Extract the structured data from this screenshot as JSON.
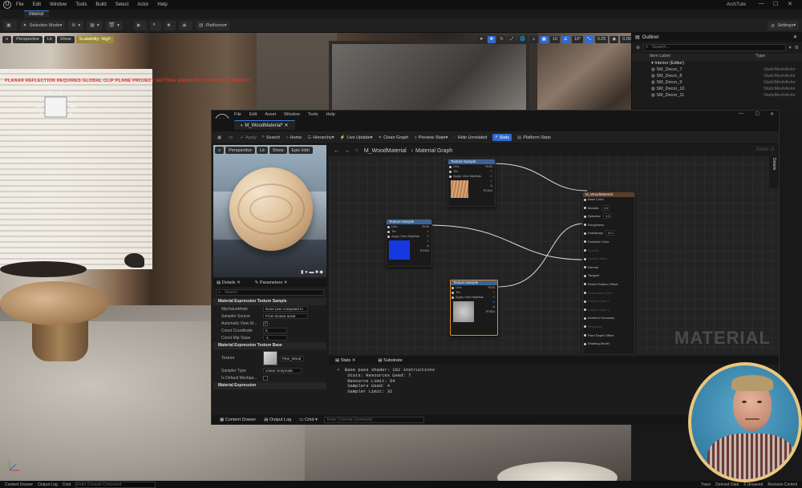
{
  "menubar": {
    "items": [
      "File",
      "Edit",
      "Window",
      "Tools",
      "Build",
      "Select",
      "Actor",
      "Help"
    ],
    "app_name": "ArchTute"
  },
  "level_tab": "Interior",
  "toolbar": {
    "selection_mode": "Selection Mode",
    "platforms": "Platforms",
    "settings": "Settings"
  },
  "viewport": {
    "perspective": "Perspective",
    "lit": "Lit",
    "show": "Show",
    "scalability": "Scalability: High",
    "warning": "PLANAR REFLECTION REQUIRES GLOBAL CLIP PLANE PROJECT SETTING ENABLED TO WORK PROPERLY",
    "grid_size": "10",
    "rotation_snap": "10°",
    "scale_snap": "0.25",
    "camera_speed": "0.002"
  },
  "outliner": {
    "title": "Outliner",
    "search_placeholder": "Search...",
    "col_label": "Item Label",
    "col_type": "Type",
    "root": "Interior (Editor)",
    "rows": [
      {
        "name": "SM_Decor_7",
        "type": "StaticMeshActor"
      },
      {
        "name": "SM_Decor_8",
        "type": "StaticMeshActor"
      },
      {
        "name": "SM_Decor_9",
        "type": "StaticMeshActor"
      },
      {
        "name": "SM_Decor_10",
        "type": "StaticMeshActor"
      },
      {
        "name": "SM_Decor_11",
        "type": "StaticMeshActor"
      }
    ]
  },
  "material_editor": {
    "menu": [
      "File",
      "Edit",
      "Asset",
      "Window",
      "Tools",
      "Help"
    ],
    "tab": "M_WoodMaterial*",
    "toolbar": {
      "apply": "Apply",
      "search": "Search",
      "home": "Home",
      "hierarchy": "Hierarchy",
      "live_update": "Live Update",
      "clean_graph": "Clean Graph",
      "preview_state": "Preview State",
      "hide_unrelated": "Hide Unrelated",
      "stats": "Stats",
      "platform_stats": "Platform Stats"
    },
    "preview": {
      "perspective": "Perspective",
      "lit": "Lit",
      "show": "Show",
      "epic_hdri": "Epic Hdri"
    },
    "left_tabs": {
      "details": "Details",
      "parameters": "Parameters"
    },
    "details": {
      "search_placeholder": "Search",
      "section1": "Material Expression Texture Sample",
      "props1": [
        {
          "k": "MipValueMode",
          "v": "None (use computed m"
        },
        {
          "k": "Sampler Source",
          "v": "From texture asset"
        },
        {
          "k": "Automatic View M...",
          "v": "✓"
        },
        {
          "k": "Const Coordinate",
          "v": "0"
        },
        {
          "k": "Const Mip Value",
          "v": "-1"
        }
      ],
      "section2": "Material Expression Texture Base",
      "texture_label": "Texture",
      "texture_value": "Pine_Wood",
      "sampler_type_label": "Sampler Type",
      "sampler_type_value": "Linear Grayscale",
      "default_meshpaint_label": "Is Default Meshpa...",
      "section3": "Material Expression"
    },
    "graph": {
      "breadcrumb_root": "M_WoodMaterial",
      "breadcrumb_child": "Material Graph",
      "zoom": "Zoom -3",
      "watermark": "MATERIAL",
      "details_side": "Details",
      "texture_node_title": "Texture Sample",
      "pins_uv": "UVs",
      "pins_tex": "Tex",
      "pins_apply": "Apply View MipBias",
      "out_rgb": "RGB",
      "out_r": "R",
      "out_g": "G",
      "out_b": "B",
      "out_a": "A",
      "out_rgba": "RGBA",
      "main_title": "M_WoodMaterial",
      "main_pins": [
        "Base Color",
        "Metallic",
        "Specular",
        "Roughness",
        "Anisotropy",
        "Emissive Color",
        "Opacity",
        "Opacity Mask",
        "Normal",
        "Tangent",
        "World Position Offset",
        "Subsurface Color",
        "Custom Data 0",
        "Custom Data 1",
        "Ambient Occlusion",
        "Refraction",
        "Pixel Depth Offset",
        "Shading Model"
      ],
      "val_metallic": "0.0",
      "val_specular": "0.5",
      "val_anisotropy": "0.0"
    },
    "stats_tabs": {
      "stats": "Stats",
      "substrate": "Substrate"
    },
    "stats_text": "•  Base pass shader: 162 instructions\n    Stats: Resources Used: 7\n    Resource Limit: 64\n    Samplers Used: 4\n    Sampler Limit: 32",
    "bottom": {
      "content_drawer": "Content Drawer",
      "output_log": "Output Log",
      "cmd": "Cmd",
      "cmd_placeholder": "Enter Console Command"
    }
  },
  "statusbar": {
    "content_drawer": "Content Drawer",
    "output_log": "Output Log",
    "cmd": "Cmd",
    "cmd_placeholder": "Enter Console Command",
    "trace": "Trace",
    "derived_data": "Derived Data",
    "unsaved": "6 Unsaved",
    "revision_control": "Revision Control"
  },
  "colors": {
    "accent_blue": "#2f6bd1",
    "selected_orange": "#e58b16",
    "warning_red": "#e0322b",
    "cam_ring": "#e9c77e"
  }
}
